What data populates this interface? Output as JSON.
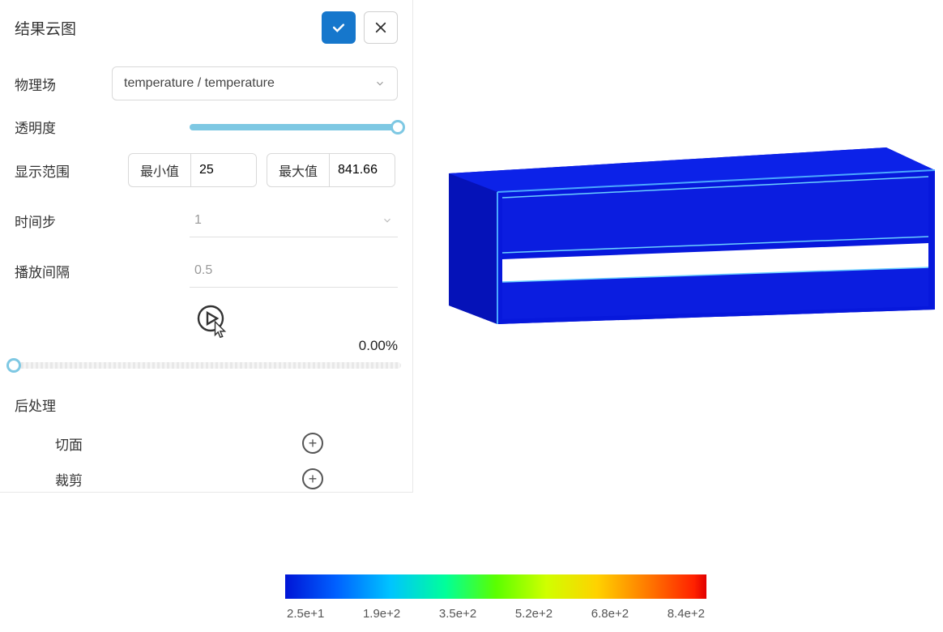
{
  "panel": {
    "title": "结果云图"
  },
  "fields": {
    "physics_label": "物理场",
    "physics_value": "temperature / temperature",
    "opacity_label": "透明度",
    "range_label": "显示范围",
    "min_label": "最小值",
    "min_value": "25",
    "max_label": "最大值",
    "max_value": "841.66",
    "timestep_label": "时间步",
    "timestep_value": "1",
    "interval_label": "播放间隔",
    "interval_value": "0.5",
    "progress_percent": "0.00%"
  },
  "post": {
    "section": "后处理",
    "slice_label": "切面",
    "clip_label": "裁剪"
  },
  "legend": {
    "ticks": [
      "2.5e+1",
      "1.9e+2",
      "3.5e+2",
      "5.2e+2",
      "6.8e+2",
      "8.4e+2"
    ]
  }
}
